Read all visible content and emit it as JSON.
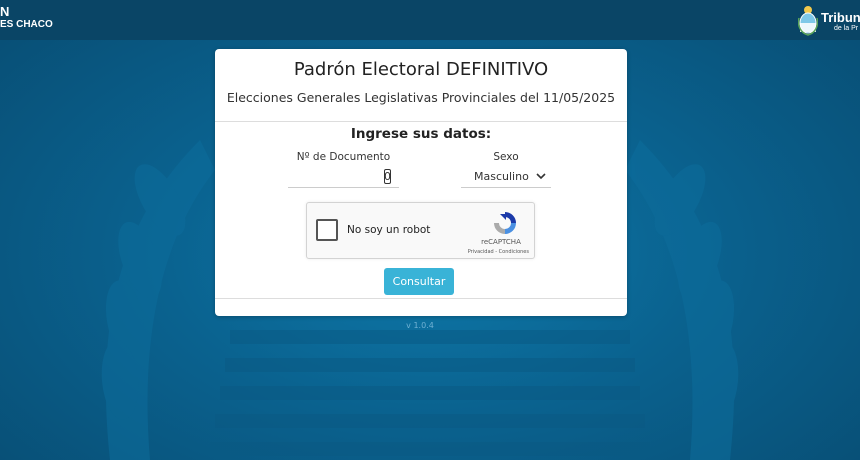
{
  "header": {
    "left_logo_line1": "N",
    "left_logo_line2": "ES CHACO",
    "right_logo_line1": "Tribun",
    "right_logo_line2": "de la Pr"
  },
  "form": {
    "title": "Padrón Electoral DEFINITIVO",
    "subtitle": "Elecciones Generales Legislativas Provinciales del 11/05/2025",
    "prompt": "Ingrese sus datos:",
    "document_label": "Nº de Documento",
    "document_value": "0",
    "sex_label": "Sexo",
    "sex_selected": "Masculino",
    "submit_label": "Consultar"
  },
  "captcha": {
    "label": "No soy un robot",
    "brand": "reCAPTCHA",
    "links": "Privacidad - Condiciones"
  },
  "footer": {
    "version": "v 1.0.4"
  },
  "icons": {
    "dropdown": "chevron-down-icon",
    "captcha": "recaptcha-icon",
    "emblem": "coat-of-arms-icon"
  },
  "colors": {
    "background": "#0b5c86",
    "topbar": "#0a4566",
    "button": "#39b3d7"
  }
}
